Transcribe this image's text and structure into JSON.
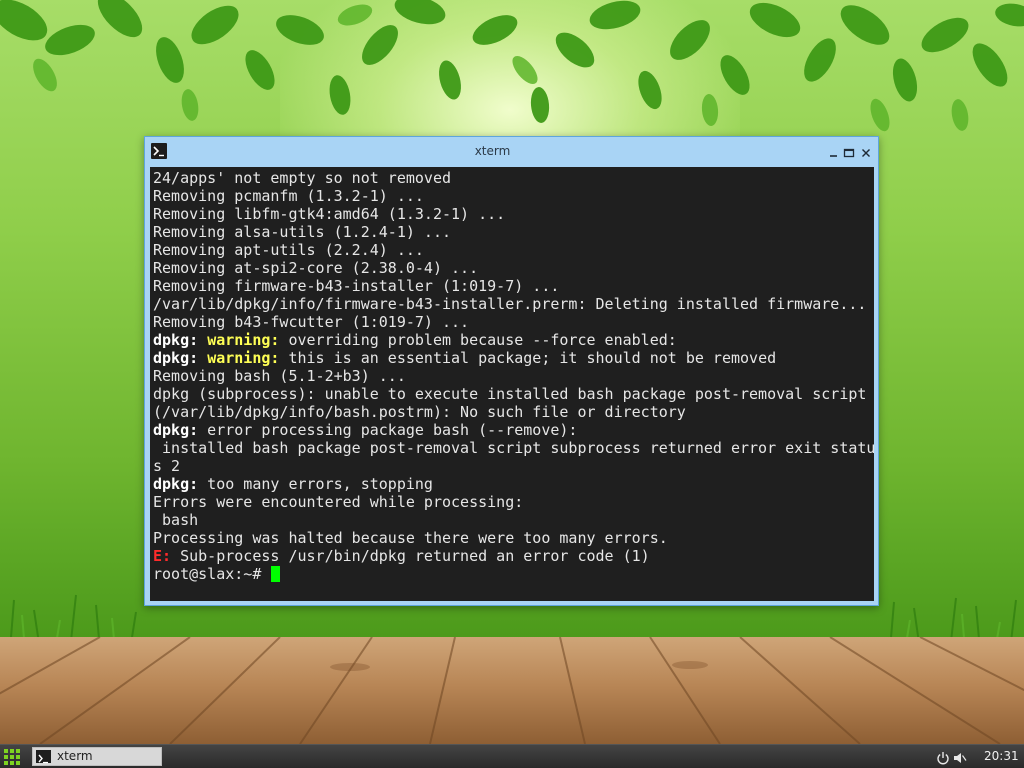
{
  "window": {
    "title": "xterm"
  },
  "terminal": {
    "lines": [
      [
        {
          "t": "24/apps' not empty so not removed",
          "s": ""
        }
      ],
      [
        {
          "t": "Removing pcmanfm (1.3.2-1) ...",
          "s": ""
        }
      ],
      [
        {
          "t": "Removing libfm-gtk4:amd64 (1.3.2-1) ...",
          "s": ""
        }
      ],
      [
        {
          "t": "Removing alsa-utils (1.2.4-1) ...",
          "s": ""
        }
      ],
      [
        {
          "t": "Removing apt-utils (2.2.4) ...",
          "s": ""
        }
      ],
      [
        {
          "t": "Removing at-spi2-core (2.38.0-4) ...",
          "s": ""
        }
      ],
      [
        {
          "t": "Removing firmware-b43-installer (1:019-7) ...",
          "s": ""
        }
      ],
      [
        {
          "t": "/var/lib/dpkg/info/firmware-b43-installer.prerm: Deleting installed firmware...",
          "s": ""
        }
      ],
      [
        {
          "t": "Removing b43-fwcutter (1:019-7) ...",
          "s": ""
        }
      ],
      [
        {
          "t": "dpkg:",
          "s": "bold"
        },
        {
          "t": " ",
          "s": ""
        },
        {
          "t": "warning:",
          "s": "warning"
        },
        {
          "t": " overriding problem because --force enabled:",
          "s": ""
        }
      ],
      [
        {
          "t": "dpkg:",
          "s": "bold"
        },
        {
          "t": " ",
          "s": ""
        },
        {
          "t": "warning:",
          "s": "warning"
        },
        {
          "t": " this is an essential package; it should not be removed",
          "s": ""
        }
      ],
      [
        {
          "t": "Removing bash (5.1-2+b3) ...",
          "s": ""
        }
      ],
      [
        {
          "t": "dpkg (subprocess): unable to execute installed bash package post-removal script",
          "s": ""
        }
      ],
      [
        {
          "t": "(/var/lib/dpkg/info/bash.postrm): No such file or directory",
          "s": ""
        }
      ],
      [
        {
          "t": "dpkg:",
          "s": "bold"
        },
        {
          "t": " error processing package bash (--remove):",
          "s": ""
        }
      ],
      [
        {
          "t": " installed bash package post-removal script subprocess returned error exit statu",
          "s": ""
        }
      ],
      [
        {
          "t": "s 2",
          "s": ""
        }
      ],
      [
        {
          "t": "dpkg:",
          "s": "bold"
        },
        {
          "t": " too many errors, stopping",
          "s": ""
        }
      ],
      [
        {
          "t": "Errors were encountered while processing:",
          "s": ""
        }
      ],
      [
        {
          "t": " bash",
          "s": ""
        }
      ],
      [
        {
          "t": "Processing was halted because there were too many errors.",
          "s": ""
        }
      ],
      [
        {
          "t": "E:",
          "s": "error"
        },
        {
          "t": " Sub-process /usr/bin/dpkg returned an error code (1)",
          "s": ""
        }
      ]
    ],
    "prompt": "root@slax:~# "
  },
  "taskbar": {
    "task_label": "xterm",
    "clock": "20:31"
  },
  "icons": {
    "app": "terminal-icon",
    "minimize": "minimize-icon",
    "maximize": "maximize-icon",
    "close": "close-icon",
    "start": "app-grid-icon",
    "power": "power-icon",
    "volume": "volume-muted-icon"
  },
  "colors": {
    "terminal_bg": "#1f1f1f",
    "terminal_fg": "#e6e6e6",
    "warning": "#ffff55",
    "error": "#ff2b2b",
    "cursor": "#00ff00",
    "window_frame": "#a9d4f5",
    "start_green": "#7ed321"
  }
}
